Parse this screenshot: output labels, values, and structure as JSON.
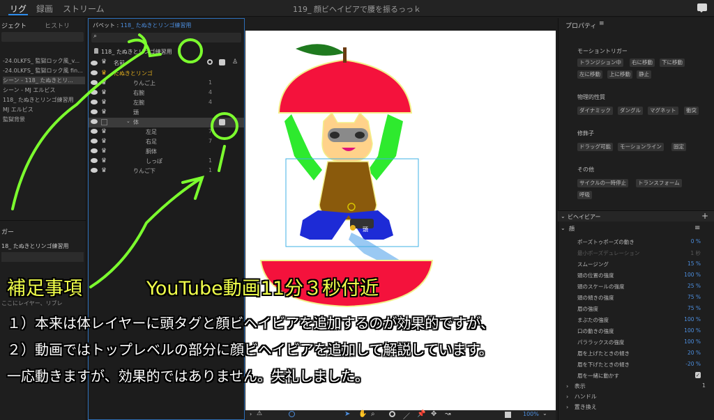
{
  "topbar": {
    "tabs": [
      "リグ",
      "録画",
      "ストリーム"
    ],
    "window_title": "119_ 顔ビヘイビアで腰を振るっっｋ"
  },
  "left_panel": {
    "tab_project": "ジェクト",
    "tab_history": "ヒストリ",
    "items": [
      "-24.0LKFS_ 監獄ロック風_v...",
      "-24.0LKFS_ 監獄ロック風 fin...",
      "シーン - 118_ たぬきとリ...",
      "シーン - MJ エルビス",
      "118_ たぬきとリンゴ練習用",
      "MJ エルビス",
      "監獄背景"
    ],
    "trigger_label": "ガー",
    "trigger_target": "18_ たぬきとリンゴ練習用",
    "hint": "ここにレイヤー、リブレ"
  },
  "puppet_panel": {
    "title_prefix": "パペット : ",
    "title_name": "118_ たぬきとリンゴ練習用",
    "breadcrumb": "118_ たぬきとリンゴ練習用",
    "col_name": "名前",
    "rows": [
      {
        "name": "たぬきとリンゴ",
        "num": ""
      },
      {
        "name": "りんご上",
        "num": "1"
      },
      {
        "name": "右腕",
        "num": "4"
      },
      {
        "name": "左腕",
        "num": "4"
      },
      {
        "name": "頭",
        "num": ""
      },
      {
        "name": "体",
        "num": ""
      },
      {
        "name": "左足",
        "num": "7"
      },
      {
        "name": "右足",
        "num": "7"
      },
      {
        "name": "胴体",
        "num": ""
      },
      {
        "name": "しっぽ",
        "num": "1"
      },
      {
        "name": "りんご下",
        "num": "1"
      }
    ]
  },
  "canvas": {
    "head_tag": "頭",
    "zoom": "100%"
  },
  "properties": {
    "title": "プロパティ",
    "motion_trigger_label": "モーショントリガー",
    "motion_trigger_chips": [
      "トランジション中",
      "右に移動",
      "下に移動",
      "左に移動",
      "上に移動",
      "静止"
    ],
    "physics_label": "物理的性質",
    "physics_chips": [
      "ダイナミック",
      "ダングル",
      "マグネット",
      "衝突"
    ],
    "modifier_label": "修飾子",
    "modifier_chips": [
      "ドラッグ可能",
      "モーションライン",
      "固定"
    ],
    "other_label": "その他",
    "other_chips": [
      "サイクルの一時停止",
      "トランスフォーム",
      "呼吸"
    ],
    "behavior_label": "ビヘイビアー",
    "face_label": "顔",
    "params": [
      {
        "label": "ポーズトゥポーズの動き",
        "value": "0 %"
      },
      {
        "label": "最小ポーズデュレーション",
        "value": "1 秒"
      },
      {
        "label": "スムージング",
        "value": "15 %"
      },
      {
        "label": "頭の位置の強度",
        "value": "100 %"
      },
      {
        "label": "頭のスケールの強度",
        "value": "25 %"
      },
      {
        "label": "頭の傾きの強度",
        "value": "75 %"
      },
      {
        "label": "眉の強度",
        "value": "75 %"
      },
      {
        "label": "まぶたの強度",
        "value": "100 %"
      },
      {
        "label": "口の動きの強度",
        "value": "100 %"
      },
      {
        "label": "パララックスの強度",
        "value": "100 %"
      },
      {
        "label": "眉を上げたときの傾き",
        "value": "20 %"
      },
      {
        "label": "眉を下げたときの傾き",
        "value": "-20 %"
      },
      {
        "label": "眉を一緒に動かす",
        "value": "✓"
      }
    ],
    "display_label": "表示",
    "display_value": "1",
    "handle_label": "ハンドル",
    "replace_label": "置き換え"
  },
  "annotation": {
    "title_left": "補足事項",
    "title_right": "YouTube動画11分３秒付近",
    "line1": "１）本来は体レイヤーに頭タグと顔ビヘイビアを追加するのが効果的ですが、",
    "line2": "２）動画ではトップレベルの部分に顔ビヘイビアを追加して解説しています。",
    "line3": "一応動きますが、効果的ではありません。失礼しました。"
  },
  "colors": {
    "accent": "#2d8ceb",
    "annotation_title": "#f0ff4a",
    "highlight_green": "#7cff2e",
    "apple_red": "#f4123c"
  }
}
